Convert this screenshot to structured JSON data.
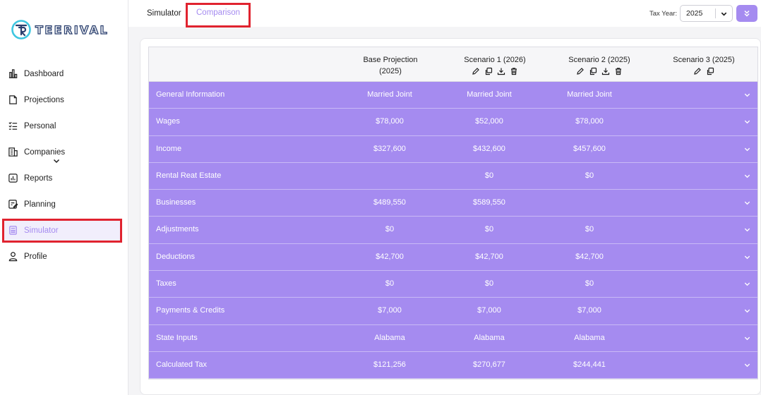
{
  "brand": {
    "name": "TEERIVAL",
    "accent": "#a58bf0",
    "highlight": "#e0232f"
  },
  "sidebar": {
    "items": [
      {
        "label": "Dashboard",
        "icon": "bar-chart-icon"
      },
      {
        "label": "Projections",
        "icon": "document-icon"
      },
      {
        "label": "Personal",
        "icon": "checklist-icon"
      },
      {
        "label": "Companies",
        "icon": "building-icon"
      },
      {
        "label": "Reports",
        "icon": "report-chart-icon"
      },
      {
        "label": "Planning",
        "icon": "edit-doc-icon"
      },
      {
        "label": "Simulator",
        "icon": "calculator-icon",
        "active": true
      },
      {
        "label": "Profile",
        "icon": "user-icon"
      }
    ]
  },
  "topbar": {
    "tabs": [
      {
        "label": "Simulator"
      },
      {
        "label": "Comparison",
        "active": true
      }
    ],
    "tax_year_label": "Tax Year:",
    "tax_year_value": "2025"
  },
  "table": {
    "columns": [
      {
        "title": "Base Projection",
        "subtitle": "(2025)"
      },
      {
        "title": "Scenario 1 (2026)",
        "actions": [
          "edit-icon",
          "copy-icon",
          "download-icon",
          "delete-icon"
        ]
      },
      {
        "title": "Scenario 2 (2025)",
        "actions": [
          "edit-icon",
          "copy-icon",
          "download-icon",
          "delete-icon"
        ]
      },
      {
        "title": "Scenario 3 (2025)",
        "actions": [
          "edit-icon",
          "copy-icon"
        ]
      }
    ],
    "rows": [
      {
        "label": "General Information",
        "values": [
          "Married Joint",
          "Married Joint",
          "Married Joint",
          ""
        ]
      },
      {
        "label": "Wages",
        "values": [
          "$78,000",
          "$52,000",
          "$78,000",
          ""
        ]
      },
      {
        "label": "Income",
        "values": [
          "$327,600",
          "$432,600",
          "$457,600",
          ""
        ]
      },
      {
        "label": "Rental Reat Estate",
        "values": [
          "",
          "$0",
          "$0",
          ""
        ]
      },
      {
        "label": "Businesses",
        "values": [
          "$489,550",
          "$589,550",
          "",
          ""
        ]
      },
      {
        "label": "Adjustments",
        "values": [
          "$0",
          "$0",
          "$0",
          ""
        ]
      },
      {
        "label": "Deductions",
        "values": [
          "$42,700",
          "$42,700",
          "$42,700",
          ""
        ]
      },
      {
        "label": "Taxes",
        "values": [
          "$0",
          "$0",
          "$0",
          ""
        ]
      },
      {
        "label": "Payments & Credits",
        "values": [
          "$7,000",
          "$7,000",
          "$7,000",
          ""
        ]
      },
      {
        "label": "State Inputs",
        "values": [
          "Alabama",
          "Alabama",
          "Alabama",
          ""
        ]
      },
      {
        "label": "Calculated Tax",
        "values": [
          "$121,256",
          "$270,677",
          "$244,441",
          ""
        ]
      }
    ]
  }
}
